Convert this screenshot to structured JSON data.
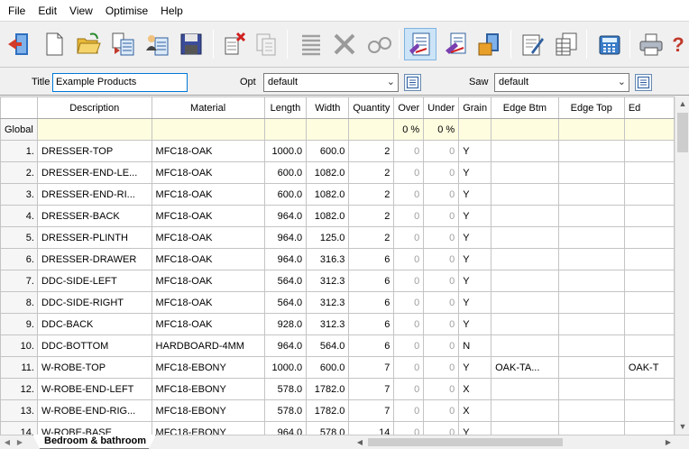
{
  "menu": [
    "File",
    "Edit",
    "View",
    "Optimise",
    "Help"
  ],
  "toolbar_icons": [
    "exit-icon",
    "new-icon",
    "open-icon",
    "import-icon",
    "import-user-icon",
    "save-icon",
    "delete-icon",
    "copy-icon",
    "align-rows-icon",
    "cut-icon",
    "glasses-icon",
    "parts-list-icon",
    "board-list-icon",
    "stock-icon",
    "edit-report-icon",
    "report-table-icon",
    "calculator-icon",
    "print-icon",
    "help-icon"
  ],
  "options": {
    "title_label": "Title",
    "title_value": "Example Products",
    "opt_label": "Opt",
    "opt_value": "default",
    "saw_label": "Saw",
    "saw_value": "default"
  },
  "grid": {
    "headers": [
      "Description",
      "Material",
      "Length",
      "Width",
      "Quantity",
      "Over",
      "Under",
      "Grain",
      "Edge Btm",
      "Edge Top",
      "Ed"
    ],
    "global_row": {
      "label": "Global",
      "over": "0 %",
      "under": "0 %"
    },
    "rows": [
      {
        "n": "1.",
        "desc": "DRESSER-TOP",
        "mat": "MFC18-OAK",
        "len": "1000.0",
        "wid": "600.0",
        "qty": "2",
        "over": "0",
        "under": "0",
        "grain": "Y",
        "ebtm": "",
        "etop": "",
        "ed": ""
      },
      {
        "n": "2.",
        "desc": "DRESSER-END-LE...",
        "mat": "MFC18-OAK",
        "len": "600.0",
        "wid": "1082.0",
        "qty": "2",
        "over": "0",
        "under": "0",
        "grain": "Y",
        "ebtm": "",
        "etop": "",
        "ed": ""
      },
      {
        "n": "3.",
        "desc": "DRESSER-END-RI...",
        "mat": "MFC18-OAK",
        "len": "600.0",
        "wid": "1082.0",
        "qty": "2",
        "over": "0",
        "under": "0",
        "grain": "Y",
        "ebtm": "",
        "etop": "",
        "ed": ""
      },
      {
        "n": "4.",
        "desc": "DRESSER-BACK",
        "mat": "MFC18-OAK",
        "len": "964.0",
        "wid": "1082.0",
        "qty": "2",
        "over": "0",
        "under": "0",
        "grain": "Y",
        "ebtm": "",
        "etop": "",
        "ed": ""
      },
      {
        "n": "5.",
        "desc": "DRESSER-PLINTH",
        "mat": "MFC18-OAK",
        "len": "964.0",
        "wid": "125.0",
        "qty": "2",
        "over": "0",
        "under": "0",
        "grain": "Y",
        "ebtm": "",
        "etop": "",
        "ed": ""
      },
      {
        "n": "6.",
        "desc": "DRESSER-DRAWER",
        "mat": "MFC18-OAK",
        "len": "964.0",
        "wid": "316.3",
        "qty": "6",
        "over": "0",
        "under": "0",
        "grain": "Y",
        "ebtm": "",
        "etop": "",
        "ed": ""
      },
      {
        "n": "7.",
        "desc": "DDC-SIDE-LEFT",
        "mat": "MFC18-OAK",
        "len": "564.0",
        "wid": "312.3",
        "qty": "6",
        "over": "0",
        "under": "0",
        "grain": "Y",
        "ebtm": "",
        "etop": "",
        "ed": ""
      },
      {
        "n": "8.",
        "desc": "DDC-SIDE-RIGHT",
        "mat": "MFC18-OAK",
        "len": "564.0",
        "wid": "312.3",
        "qty": "6",
        "over": "0",
        "under": "0",
        "grain": "Y",
        "ebtm": "",
        "etop": "",
        "ed": ""
      },
      {
        "n": "9.",
        "desc": "DDC-BACK",
        "mat": "MFC18-OAK",
        "len": "928.0",
        "wid": "312.3",
        "qty": "6",
        "over": "0",
        "under": "0",
        "grain": "Y",
        "ebtm": "",
        "etop": "",
        "ed": ""
      },
      {
        "n": "10.",
        "desc": "DDC-BOTTOM",
        "mat": "HARDBOARD-4MM",
        "len": "964.0",
        "wid": "564.0",
        "qty": "6",
        "over": "0",
        "under": "0",
        "grain": "N",
        "ebtm": "",
        "etop": "",
        "ed": ""
      },
      {
        "n": "11.",
        "desc": "W-ROBE-TOP",
        "mat": "MFC18-EBONY",
        "len": "1000.0",
        "wid": "600.0",
        "qty": "7",
        "over": "0",
        "under": "0",
        "grain": "Y",
        "ebtm": "OAK-TA...",
        "etop": "",
        "ed": "OAK-T"
      },
      {
        "n": "12.",
        "desc": "W-ROBE-END-LEFT",
        "mat": "MFC18-EBONY",
        "len": "578.0",
        "wid": "1782.0",
        "qty": "7",
        "over": "0",
        "under": "0",
        "grain": "X",
        "ebtm": "",
        "etop": "",
        "ed": ""
      },
      {
        "n": "13.",
        "desc": "W-ROBE-END-RIG...",
        "mat": "MFC18-EBONY",
        "len": "578.0",
        "wid": "1782.0",
        "qty": "7",
        "over": "0",
        "under": "0",
        "grain": "X",
        "ebtm": "",
        "etop": "",
        "ed": ""
      },
      {
        "n": "14.",
        "desc": "W-ROBE-BASE",
        "mat": "MFC18-EBONY",
        "len": "964.0",
        "wid": "578.0",
        "qty": "14",
        "over": "0",
        "under": "0",
        "grain": "Y",
        "ebtm": "",
        "etop": "",
        "ed": ""
      }
    ]
  },
  "sheet_tab": "Bedroom & bathroom"
}
